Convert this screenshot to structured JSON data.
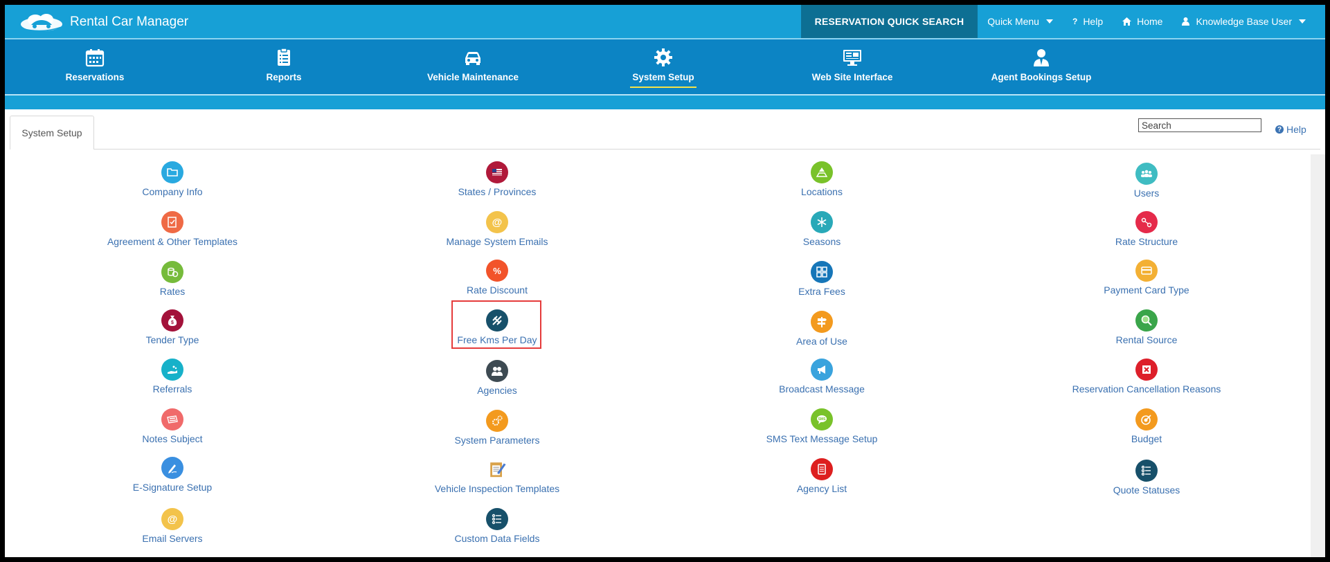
{
  "app": {
    "name": "Rental Car Manager",
    "quick_search": "RESERVATION QUICK SEARCH",
    "top_links": [
      {
        "label": "Quick Menu",
        "icon": "caret-down-icon"
      },
      {
        "label": "Help",
        "icon": "question-icon"
      },
      {
        "label": "Home",
        "icon": "home-icon"
      },
      {
        "label": "Knowledge Base User",
        "icon": "user-icon"
      }
    ]
  },
  "nav": [
    {
      "label": "Reservations",
      "icon": "calendar-icon"
    },
    {
      "label": "Reports",
      "icon": "clipboard-icon"
    },
    {
      "label": "Vehicle Maintenance",
      "icon": "car-icon"
    },
    {
      "label": "System Setup",
      "icon": "gear-icon",
      "active": true
    },
    {
      "label": "Web Site Interface",
      "icon": "monitor-icon"
    },
    {
      "label": "Agent Bookings Setup",
      "icon": "agent-icon"
    }
  ],
  "tab": "System Setup",
  "search": {
    "placeholder": "Search"
  },
  "help": "Help",
  "columns": [
    [
      {
        "label": "Company Info",
        "icon": "folder-icon",
        "color": "#29a9e0"
      },
      {
        "label": "Agreement & Other Templates",
        "icon": "template-icon",
        "color": "#ef6a45"
      },
      {
        "label": "Rates",
        "icon": "coins-icon",
        "color": "#76bb3b"
      },
      {
        "label": "Tender Type",
        "icon": "money-bag-icon",
        "color": "#a3123a"
      },
      {
        "label": "Referrals",
        "icon": "referral-hand-icon",
        "color": "#17b1c9"
      },
      {
        "label": "Notes Subject",
        "icon": "notes-icon",
        "color": "#f06a6a"
      },
      {
        "label": "E-Signature Setup",
        "icon": "pen-icon",
        "color": "#3a8fe0"
      },
      {
        "label": "Email Servers",
        "icon": "at-icon",
        "color": "#f3c34b"
      }
    ],
    [
      {
        "label": "States / Provinces",
        "icon": "flag-icon",
        "color": "#b0193a"
      },
      {
        "label": "Manage System Emails",
        "icon": "at-icon",
        "color": "#f3c34b"
      },
      {
        "label": "Rate Discount",
        "icon": "percent-icon",
        "color": "#f2532a"
      },
      {
        "label": "Free Kms Per Day",
        "icon": "road-icon",
        "color": "#17506a"
      },
      {
        "label": "Agencies",
        "icon": "agencies-icon",
        "color": "#3d4a52"
      },
      {
        "label": "System Parameters",
        "icon": "gears-icon",
        "color": "#f39a1e"
      },
      {
        "label": "Vehicle Inspection Templates",
        "icon": "clipboard-pencil-icon",
        "color": "#d9a24a"
      },
      {
        "label": "Custom Data Fields",
        "icon": "list-icon",
        "color": "#17506a"
      }
    ],
    [
      {
        "label": "Locations",
        "icon": "map-pin-icon",
        "color": "#79c22a"
      },
      {
        "label": "Seasons",
        "icon": "snowflake-icon",
        "color": "#29a9b8"
      },
      {
        "label": "Extra Fees",
        "icon": "grid-icon",
        "color": "#1676b8"
      },
      {
        "label": "Area of Use",
        "icon": "signpost-icon",
        "color": "#f39a1e"
      },
      {
        "label": "Broadcast Message",
        "icon": "megaphone-icon",
        "color": "#3aa3dd"
      },
      {
        "label": "SMS Text Message Setup",
        "icon": "sms-icon",
        "color": "#79c22a"
      },
      {
        "label": "Agency List",
        "icon": "document-icon",
        "color": "#dd1f1f"
      }
    ],
    [
      {
        "label": "Users",
        "icon": "users-icon",
        "color": "#3fbcc2"
      },
      {
        "label": "Rate Structure",
        "icon": "structure-icon",
        "color": "#e52a4a"
      },
      {
        "label": "Payment Card Type",
        "icon": "credit-card-icon",
        "color": "#f3b034"
      },
      {
        "label": "Rental Source",
        "icon": "magnifier-icon",
        "color": "#3aa54a"
      },
      {
        "label": "Reservation Cancellation Reasons",
        "icon": "cancel-icon",
        "color": "#dd1f2a"
      },
      {
        "label": "Budget",
        "icon": "target-icon",
        "color": "#f39a1e"
      },
      {
        "label": "Quote Statuses",
        "icon": "list-icon",
        "color": "#17506a"
      }
    ]
  ]
}
